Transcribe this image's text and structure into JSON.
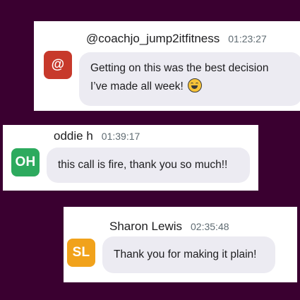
{
  "messages": [
    {
      "avatar": {
        "text": "@",
        "color": "#c7392b"
      },
      "username": "@coachjo_jump2itfitness",
      "time": "01:23:27",
      "text_line1": "Getting on this was the best decision",
      "text_line2": "I’ve made all week!",
      "emoji_icon": "tears-of-joy-emoji-icon"
    },
    {
      "avatar": {
        "text": "OH",
        "color": "#2daa5e"
      },
      "username": "oddie h",
      "time": "01:39:17",
      "text": "this call is fire, thank you so much!!"
    },
    {
      "avatar": {
        "text": "SL",
        "color": "#f1a21b"
      },
      "username": "Sharon Lewis",
      "time": "02:35:48",
      "text": "Thank you for making it plain!"
    }
  ]
}
